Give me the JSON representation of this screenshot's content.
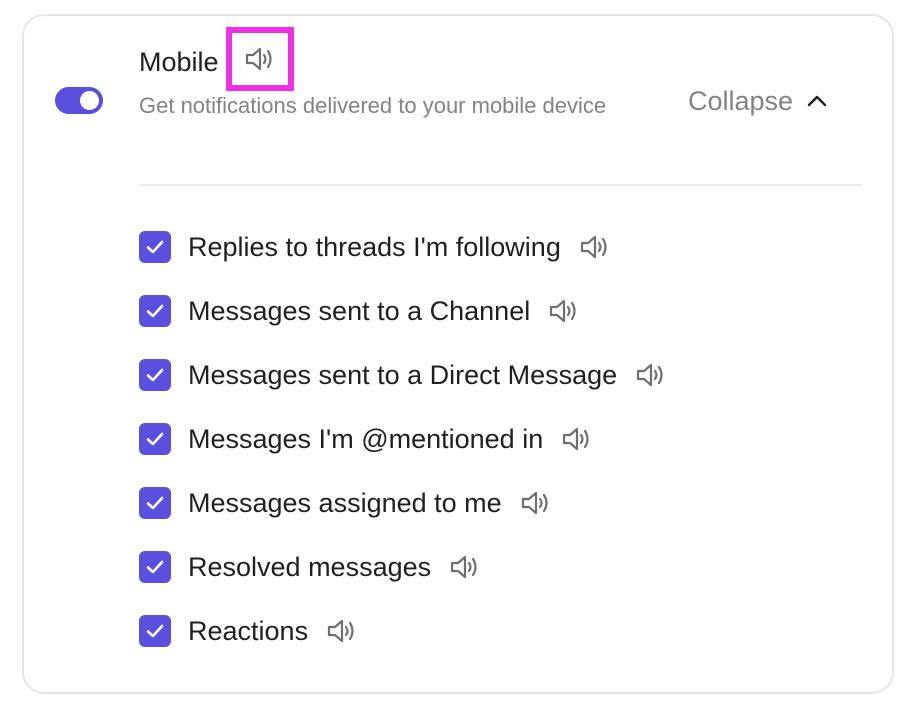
{
  "header": {
    "title": "Mobile",
    "description": "Get notifications delivered to your mobile device",
    "toggle_on": true,
    "collapse_label": "Collapse"
  },
  "options": [
    {
      "label": "Replies to threads I'm following",
      "checked": true
    },
    {
      "label": "Messages sent to a Channel",
      "checked": true
    },
    {
      "label": "Messages sent to a Direct Message",
      "checked": true
    },
    {
      "label": "Messages I'm @mentioned in",
      "checked": true
    },
    {
      "label": "Messages assigned to me",
      "checked": true
    },
    {
      "label": "Resolved messages",
      "checked": true
    },
    {
      "label": "Reactions",
      "checked": true
    }
  ],
  "icons": {
    "speaker": "speaker-icon",
    "collapse": "chevron-up-icon",
    "check": "checkmark-icon"
  },
  "colors": {
    "accent": "#5b4fe0",
    "highlight": "#ee2fe6",
    "muted_text": "#828287",
    "text": "#1f1f24"
  }
}
